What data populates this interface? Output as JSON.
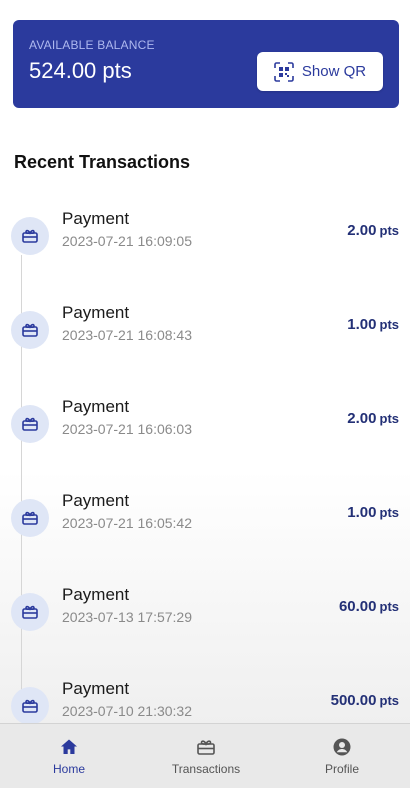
{
  "balance": {
    "label": "AVAILABLE BALANCE",
    "value": "524.00 pts",
    "qr_button_label": "Show QR"
  },
  "transactions_section": {
    "title": "Recent Transactions",
    "items": [
      {
        "title": "Payment",
        "date": "2023-07-21 16:09:05",
        "amount": "2.00",
        "unit": "pts",
        "icon": "gift-card-icon"
      },
      {
        "title": "Payment",
        "date": "2023-07-21 16:08:43",
        "amount": "1.00",
        "unit": "pts",
        "icon": "gift-card-icon"
      },
      {
        "title": "Payment",
        "date": "2023-07-21 16:06:03",
        "amount": "2.00",
        "unit": "pts",
        "icon": "gift-card-icon"
      },
      {
        "title": "Payment",
        "date": "2023-07-21 16:05:42",
        "amount": "1.00",
        "unit": "pts",
        "icon": "gift-card-icon"
      },
      {
        "title": "Payment",
        "date": "2023-07-13 17:57:29",
        "amount": "60.00",
        "unit": "pts",
        "icon": "gift-card-icon"
      },
      {
        "title": "Payment",
        "date": "2023-07-10 21:30:32",
        "amount": "500.00",
        "unit": "pts",
        "icon": "gift-card-icon"
      }
    ]
  },
  "bottom_nav": {
    "items": [
      {
        "label": "Home",
        "icon": "home-icon",
        "active": true
      },
      {
        "label": "Transactions",
        "icon": "gift-card-icon",
        "active": false
      },
      {
        "label": "Profile",
        "icon": "user-circle-icon",
        "active": false
      }
    ]
  },
  "colors": {
    "primary": "#2b3a9d",
    "amount": "#233076",
    "icon_bg": "#dfe6f6"
  }
}
